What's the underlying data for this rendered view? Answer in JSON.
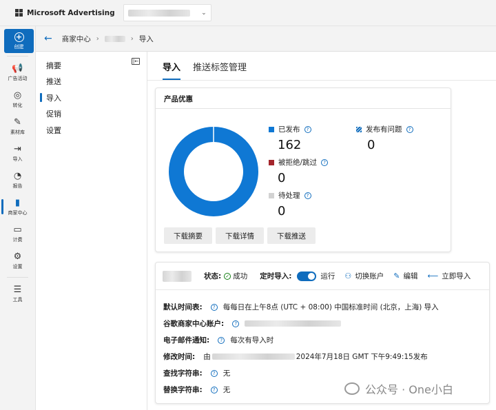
{
  "app": {
    "title": "Microsoft Advertising"
  },
  "rail": {
    "create": "创建",
    "items": [
      {
        "label": "广告活动",
        "icon": "megaphone-icon"
      },
      {
        "label": "转化",
        "icon": "target-icon"
      },
      {
        "label": "素材库",
        "icon": "image-edit-icon"
      },
      {
        "label": "导入",
        "icon": "import-arrow-icon"
      },
      {
        "label": "报告",
        "icon": "chart-icon"
      },
      {
        "label": "商家中心",
        "icon": "shopping-bag-icon"
      },
      {
        "label": "计费",
        "icon": "wallet-icon"
      },
      {
        "label": "设置",
        "icon": "gear-icon"
      },
      {
        "label": "工具",
        "icon": "tools-icon"
      }
    ]
  },
  "breadcrumb": {
    "first": "商家中心",
    "last": "导入"
  },
  "subnav": {
    "items": [
      "摘要",
      "推送",
      "导入",
      "促销",
      "设置"
    ],
    "active": "导入"
  },
  "tabs": [
    "导入",
    "推送标签管理"
  ],
  "offers": {
    "title": "产品优惠",
    "published_label": "已发布",
    "published_value": "162",
    "rejected_label": "被拒绝/跳过",
    "rejected_value": "0",
    "pending_label": "待处理",
    "pending_value": "0",
    "issues_label": "发布有问题",
    "issues_value": "0",
    "buttons": [
      "下载摘要",
      "下载详情",
      "下载推送"
    ],
    "colors": {
      "published": "#0f78d4",
      "rejected": "#a4262c",
      "pending": "#d2d2d2",
      "issues": "#0f6cbd"
    }
  },
  "import_card": {
    "status_label": "状态:",
    "status_value": "成功",
    "scheduled_label": "定时导入:",
    "scheduled_state": "运行",
    "switch_account": "切换账户",
    "edit": "编辑",
    "import_now": "立即导入",
    "rows": [
      {
        "key": "默认时间表:",
        "value": "每每日在上午8点 (UTC + 08:00) 中国标准时间 (北京，上海) 导入"
      },
      {
        "key": "谷歌商家中心账户:",
        "value": ""
      },
      {
        "key": "电子邮件通知:",
        "value": "每次有导入时"
      },
      {
        "key": "修改时间:",
        "value_prefix": "由",
        "value": "2024年7月18日 GMT 下午9:49:15发布"
      },
      {
        "key": "查找字符串:",
        "value": "无"
      },
      {
        "key": "替换字符串:",
        "value": "无"
      }
    ]
  },
  "watermark": "公众号 · One小白"
}
